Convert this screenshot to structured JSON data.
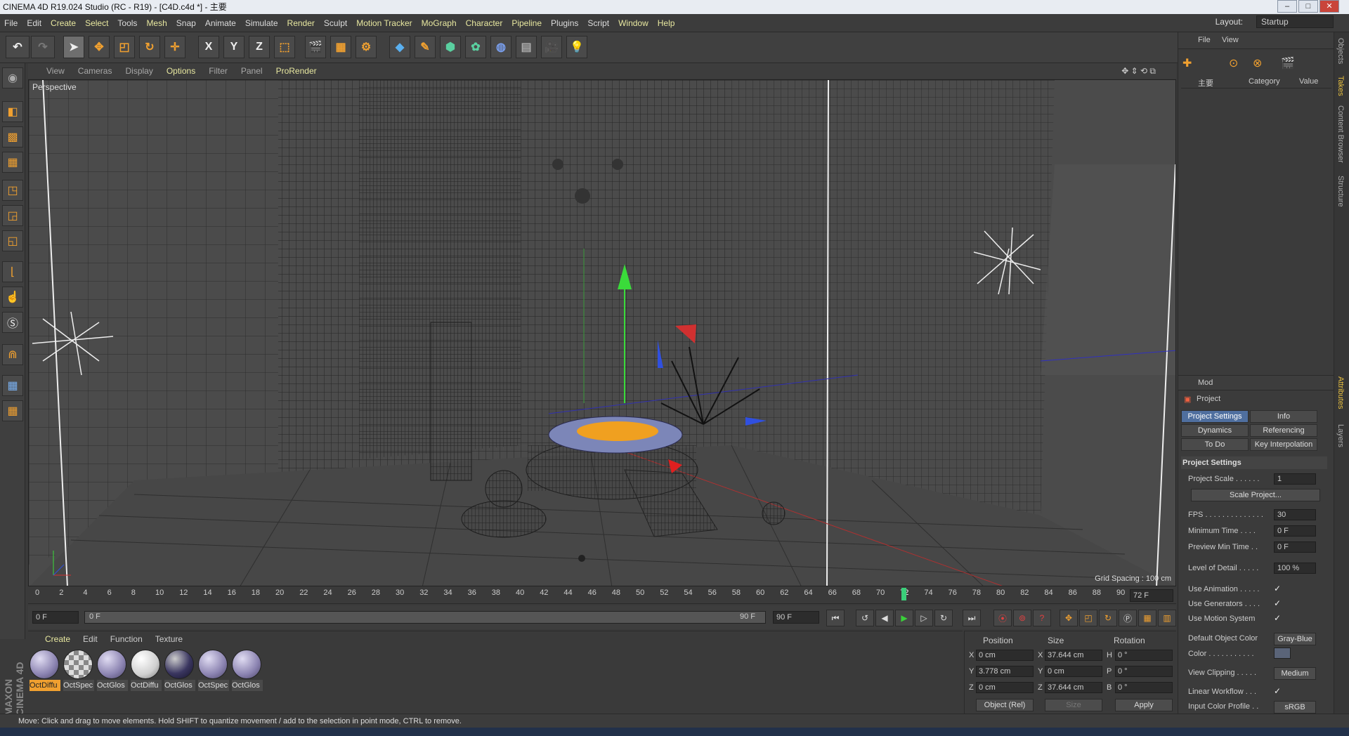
{
  "app": {
    "title": "CINEMA 4D R19.024 Studio (RC - R19) - [C4D.c4d *] - 主要"
  },
  "menu": {
    "items": [
      "File",
      "Edit",
      "Create",
      "Select",
      "Tools",
      "Mesh",
      "Snap",
      "Animate",
      "Simulate",
      "Render",
      "Sculpt",
      "Motion Tracker",
      "MoGraph",
      "Character",
      "Pipeline",
      "Plugins",
      "Script",
      "Window",
      "Help"
    ],
    "layout_label": "Layout:",
    "layout_value": "Startup"
  },
  "toolbar": {
    "x_label": "X",
    "y_label": "Y",
    "z_label": "Z"
  },
  "viewport": {
    "menu": [
      "View",
      "Cameras",
      "Display",
      "Options",
      "Filter",
      "Panel",
      "ProRender"
    ],
    "label": "Perspective",
    "grid_spacing": "Grid Spacing : 100 cm"
  },
  "timeline": {
    "ticks": [
      "0",
      "2",
      "4",
      "6",
      "8",
      "10",
      "12",
      "14",
      "16",
      "18",
      "20",
      "22",
      "24",
      "26",
      "28",
      "30",
      "32",
      "34",
      "36",
      "38",
      "40",
      "42",
      "44",
      "46",
      "48",
      "50",
      "52",
      "54",
      "56",
      "58",
      "60",
      "62",
      "64",
      "66",
      "68",
      "70",
      "72",
      "74",
      "76",
      "78",
      "80",
      "82",
      "84",
      "86",
      "88",
      "90"
    ],
    "current": "72",
    "current_field": "72 F",
    "start_field": "0 F",
    "range_start": "0 F",
    "range_end": "90 F",
    "end_field": "90 F"
  },
  "materials": {
    "menu": [
      "Create",
      "Edit",
      "Function",
      "Texture"
    ],
    "items": [
      "OctDiffu",
      "OctSpec",
      "OctGlos",
      "OctDiffu",
      "OctGlos",
      "OctSpec",
      "OctGlos"
    ]
  },
  "coordinates": {
    "headers": [
      "Position",
      "Size",
      "Rotation"
    ],
    "rows": [
      {
        "axis": "X",
        "pos": "0 cm",
        "size_axis": "X",
        "size": "37.644 cm",
        "rot_axis": "H",
        "rot": "0 °"
      },
      {
        "axis": "Y",
        "pos": "3.778 cm",
        "size_axis": "Y",
        "size": "0 cm",
        "rot_axis": "P",
        "rot": "0 °"
      },
      {
        "axis": "Z",
        "pos": "0 cm",
        "size_axis": "Z",
        "size": "37.644 cm",
        "rot_axis": "B",
        "rot": "0 °"
      }
    ],
    "mode": "Object (Rel)",
    "size_mode": "Size",
    "apply": "Apply"
  },
  "status": "Move: Click and drag to move elements. Hold SHIFT to quantize movement / add to the selection in point mode, CTRL to remove.",
  "brand": "MAXON CINEMA 4D",
  "takes": {
    "menu": [
      "File",
      "View"
    ],
    "root": "主要",
    "col_category": "Category",
    "col_value": "Value"
  },
  "attributes": {
    "mode": "Mod",
    "object": "Project",
    "tabs": [
      "Project Settings",
      "Info",
      "Dynamics",
      "Referencing",
      "To Do",
      "Key Interpolation"
    ],
    "section": "Project Settings",
    "rows": [
      {
        "label": "Project Scale . . . . . .",
        "value": "1"
      },
      {
        "label": "FPS . . . . . . . . . . . . . .",
        "value": "30"
      },
      {
        "label": "Minimum Time . . . .",
        "value": "0 F"
      },
      {
        "label": "Preview Min Time . .",
        "value": "0 F"
      },
      {
        "label": "Level of Detail . . . . .",
        "value": "100 %"
      }
    ],
    "scale_button": "Scale Project...",
    "checks": [
      {
        "label": "Use Animation . . . . . ",
        "mark": "✓"
      },
      {
        "label": "Use Generators . . . .",
        "mark": "✓"
      },
      {
        "label": "Use Motion System",
        "mark": "✓"
      }
    ],
    "default_color_label": "Default Object Color",
    "default_color_value": "Gray-Blue",
    "color_label": "Color . . . . . . . . . . .",
    "view_clipping_label": "View Clipping . . . . .",
    "view_clipping_value": "Medium",
    "linear_workflow_label": "Linear Workflow . . .",
    "linear_workflow_mark": "✓",
    "input_profile_label": "Input Color Profile . .",
    "input_profile_value": "sRGB"
  },
  "side_tabs": [
    "Objects",
    "Takes",
    "Content Browser",
    "Structure",
    "Attributes",
    "Layers"
  ]
}
